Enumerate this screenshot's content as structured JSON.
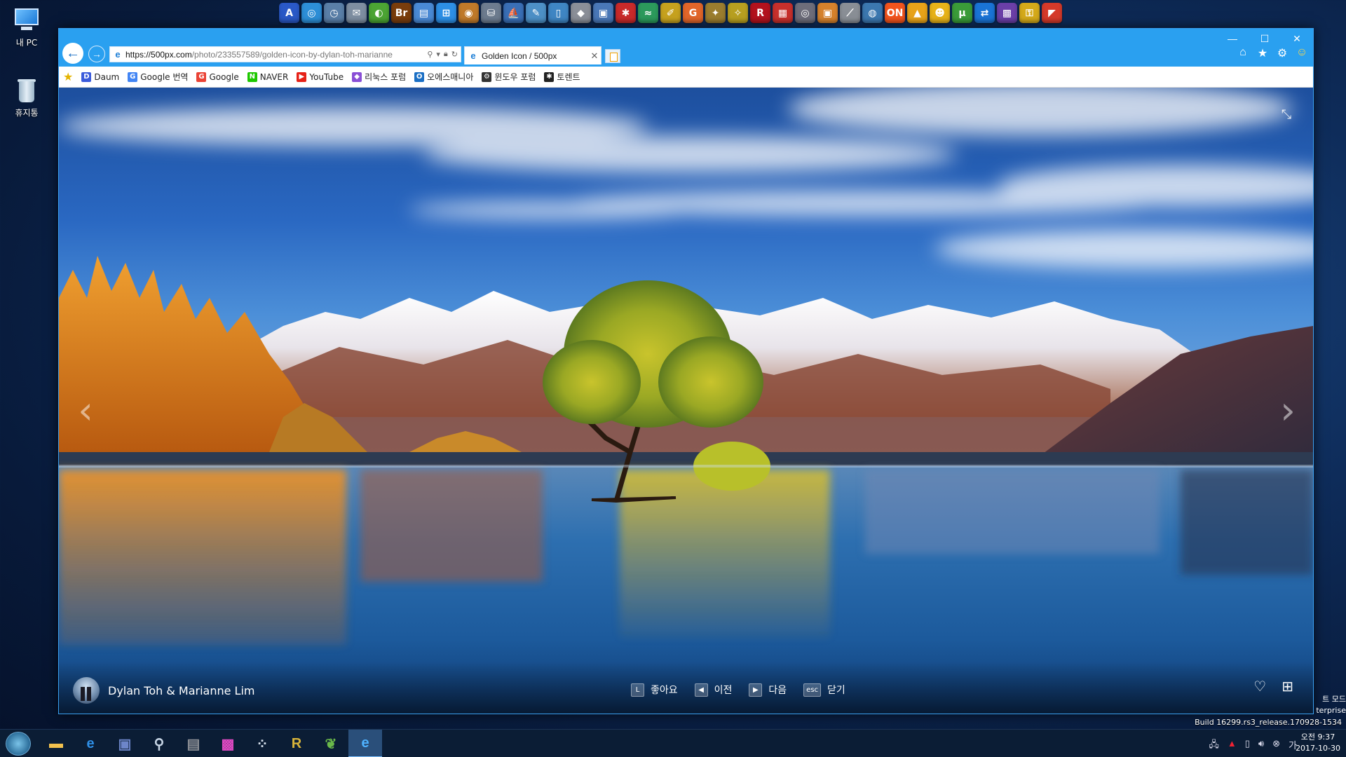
{
  "desktop": {
    "icons": [
      {
        "label": "내 PC",
        "icon": "computer-icon"
      },
      {
        "label": "휴지통",
        "icon": "recycle-bin-icon"
      }
    ],
    "watermark_mode": "트 모드",
    "watermark_edition": "terprise",
    "build": "Build 16299.rs3_release.170928-1534"
  },
  "launcher": {
    "items": [
      {
        "icon": "a-app-icon",
        "glyph": "A",
        "color": "#2a59c7"
      },
      {
        "icon": "refresh-app-icon",
        "glyph": "◎",
        "color": "#2d8fd8"
      },
      {
        "icon": "clock-app-icon",
        "glyph": "◷",
        "color": "#5a7fa8"
      },
      {
        "icon": "mail-app-icon",
        "glyph": "✉",
        "color": "#7e8ea1"
      },
      {
        "icon": "green-app-icon",
        "glyph": "◐",
        "color": "#4ca534"
      },
      {
        "icon": "bridge-app-icon",
        "glyph": "Br",
        "color": "#7a3d0c"
      },
      {
        "icon": "docs-app-icon",
        "glyph": "▤",
        "color": "#4a8ad6"
      },
      {
        "icon": "windows-app-icon",
        "glyph": "⊞",
        "color": "#2d8fe6"
      },
      {
        "icon": "camera-app-icon",
        "glyph": "◉",
        "color": "#c07a2a"
      },
      {
        "icon": "disk-app-icon",
        "glyph": "⛁",
        "color": "#6d7c8f"
      },
      {
        "icon": "ship-app-icon",
        "glyph": "⛵",
        "color": "#3a6fb6"
      },
      {
        "icon": "tool-app-icon",
        "glyph": "✎",
        "color": "#4d90c7"
      },
      {
        "icon": "phone-app-icon",
        "glyph": "▯",
        "color": "#3f86c4"
      },
      {
        "icon": "eraser-app-icon",
        "glyph": "◆",
        "color": "#8b8f98"
      },
      {
        "icon": "pc-app-icon",
        "glyph": "▣",
        "color": "#4a78b8"
      },
      {
        "icon": "bug-app-icon",
        "glyph": "✱",
        "color": "#c92a2a"
      },
      {
        "icon": "wave-app-icon",
        "glyph": "≈",
        "color": "#2c9a5c"
      },
      {
        "icon": "pen-app-icon",
        "glyph": "✐",
        "color": "#c7a21e"
      },
      {
        "icon": "g-app-icon",
        "glyph": "G",
        "color": "#e2662a"
      },
      {
        "icon": "wand-app-icon",
        "glyph": "✦",
        "color": "#9b7d2f"
      },
      {
        "icon": "stars-app-icon",
        "glyph": "✧",
        "color": "#b8a020"
      },
      {
        "icon": "r-app-icon",
        "glyph": "R",
        "color": "#b3121d"
      },
      {
        "icon": "cube-app-icon",
        "glyph": "▦",
        "color": "#c8302c"
      },
      {
        "icon": "disc-app-icon",
        "glyph": "◎",
        "color": "#6d6d7a"
      },
      {
        "icon": "box-app-icon",
        "glyph": "▣",
        "color": "#d6822c"
      },
      {
        "icon": "knife-app-icon",
        "glyph": "⟋",
        "color": "#8a8f96"
      },
      {
        "icon": "globe-app-icon",
        "glyph": "◍",
        "color": "#3c78b0"
      },
      {
        "icon": "on-app-icon",
        "glyph": "ON",
        "color": "#f2541d"
      },
      {
        "icon": "triangle-app-icon",
        "glyph": "▲",
        "color": "#e8a319"
      },
      {
        "icon": "face-app-icon",
        "glyph": "☻",
        "color": "#e8b319"
      },
      {
        "icon": "torrent-app-icon",
        "glyph": "µ",
        "color": "#3b9c39"
      },
      {
        "icon": "teamviewer-app-icon",
        "glyph": "⇄",
        "color": "#1a74d6"
      },
      {
        "icon": "chip-app-icon",
        "glyph": "▩",
        "color": "#6b3fa8"
      },
      {
        "icon": "key-app-icon",
        "glyph": "⚿",
        "color": "#d5aa1a"
      },
      {
        "icon": "flag-app-icon",
        "glyph": "◤",
        "color": "#d63a2a"
      }
    ]
  },
  "browser": {
    "url_host": "https://500px.com",
    "url_path": "/photo/233557589/golden-icon-by-dylan-toh-marianne",
    "tab_title": "Golden Icon / 500px",
    "window_controls": {
      "minimize": "—",
      "maximize": "☐",
      "close": "✕"
    },
    "favorites": [
      {
        "label": "Daum",
        "icon": "daum-icon",
        "color": "#3b5bdb",
        "glyph": "D"
      },
      {
        "label": "Google 번역",
        "icon": "google-translate-icon",
        "color": "#4285f4",
        "glyph": "G"
      },
      {
        "label": "Google",
        "icon": "google-icon",
        "color": "#ea4335",
        "glyph": "G"
      },
      {
        "label": "NAVER",
        "icon": "naver-icon",
        "color": "#1ec800",
        "glyph": "N"
      },
      {
        "label": "YouTube",
        "icon": "youtube-icon",
        "color": "#e62117",
        "glyph": "▶"
      },
      {
        "label": "리눅스 포럼",
        "icon": "linux-forum-icon",
        "color": "#8a4fd6",
        "glyph": "◆"
      },
      {
        "label": "오에스매니아",
        "icon": "osmania-icon",
        "color": "#1b6fc4",
        "glyph": "O"
      },
      {
        "label": "윈도우 포럼",
        "icon": "windows-forum-icon",
        "color": "#333333",
        "glyph": "⚙"
      },
      {
        "label": "토렌트",
        "icon": "torrent-icon",
        "color": "#222222",
        "glyph": "✱"
      }
    ]
  },
  "viewer": {
    "author": "Dylan Toh & Marianne Lim",
    "shortcuts": [
      {
        "key": "L",
        "label": "좋아요",
        "name": "like-shortcut"
      },
      {
        "key": "◀",
        "label": "이전",
        "name": "previous-shortcut"
      },
      {
        "key": "▶",
        "label": "다음",
        "name": "next-shortcut"
      },
      {
        "key": "esc",
        "label": "닫기",
        "name": "close-shortcut"
      }
    ],
    "prev_arrow": "‹",
    "next_arrow": "›"
  },
  "taskbar": {
    "apps": [
      {
        "icon": "file-explorer-icon",
        "glyph": "▬",
        "color": "#f2c14e"
      },
      {
        "icon": "internet-explorer-icon",
        "glyph": "e",
        "color": "#2f8fe6"
      },
      {
        "icon": "save-disk-icon",
        "glyph": "▣",
        "color": "#6d86c9"
      },
      {
        "icon": "magnifier-icon",
        "glyph": "⚲",
        "color": "#c8d6e6"
      },
      {
        "icon": "film-icon",
        "glyph": "▤",
        "color": "#8c8f95"
      },
      {
        "icon": "color-picker-icon",
        "glyph": "▩",
        "color": "#e04ac4"
      },
      {
        "icon": "grid-icon",
        "glyph": "⁘",
        "color": "#d8e2ee"
      },
      {
        "icon": "archive-icon",
        "glyph": "R",
        "color": "#d8b43a"
      },
      {
        "icon": "leaf-icon",
        "glyph": "❦",
        "color": "#6ab84a"
      },
      {
        "icon": "ie-active-icon",
        "glyph": "e",
        "color": "#4fb2ff"
      }
    ],
    "clock_time": "오전 9:37",
    "clock_date": "2017-10-30"
  }
}
